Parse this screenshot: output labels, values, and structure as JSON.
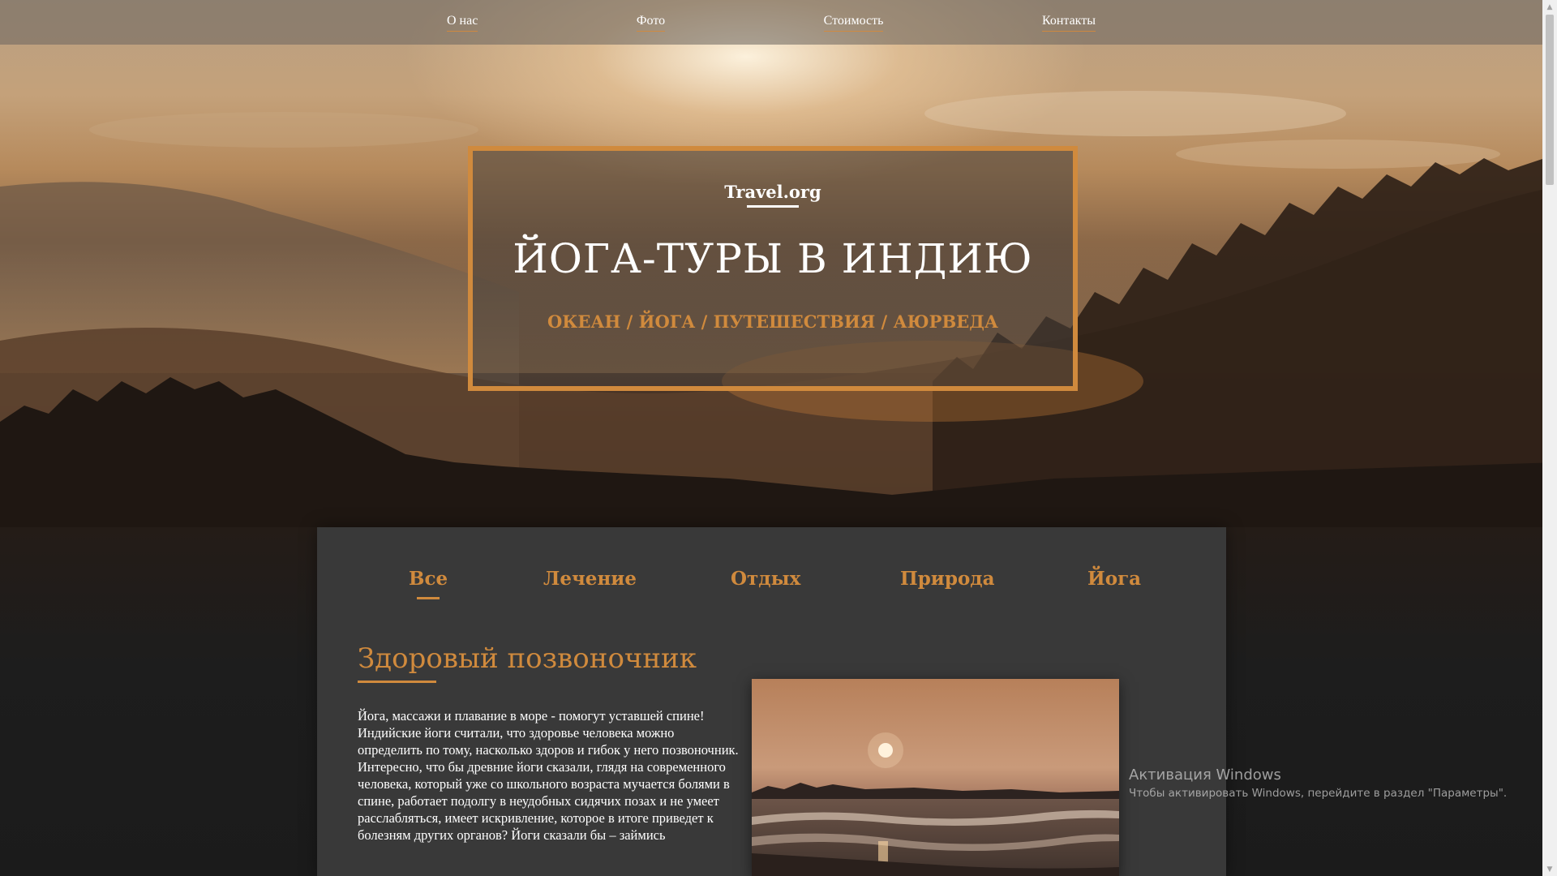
{
  "nav": {
    "items": [
      {
        "label": "О нас"
      },
      {
        "label": "Фото"
      },
      {
        "label": "Стоимость"
      },
      {
        "label": "Контакты"
      }
    ]
  },
  "hero": {
    "brand": "Travel.org",
    "title": "ЙОГА-ТУРЫ В ИНДИЮ",
    "tags": "ОКЕАН / ЙОГА / ПУТЕШЕСТВИЯ / АЮРВЕДА"
  },
  "filters": {
    "items": [
      {
        "label": "Все",
        "active": true
      },
      {
        "label": "Лечение",
        "active": false
      },
      {
        "label": "Отдых",
        "active": false
      },
      {
        "label": "Природа",
        "active": false
      },
      {
        "label": "Йога",
        "active": false
      }
    ]
  },
  "article": {
    "title": "Здоровый позвоночник",
    "paragraph1": "Йога, массажи и плавание в море - помогут уставшей спине! Индийские йоги считали, что здоровье человека можно определить по тому, насколько здоров и гибок у него позвоночник.",
    "paragraph2": "Интересно, что бы древние йоги сказали, глядя на современного человека, который уже со школьного возраста мучается болями в спине, работает подолгу в неудобных сидячих позах и не умеет расслабляться, имеет искривление, которое в итоге приведет к болезням других органов? Йоги сказали бы – займись"
  },
  "watermark": {
    "title": "Активация Windows",
    "text": "Чтобы активировать Windows, перейдите в раздел \"Параметры\"."
  },
  "colors": {
    "accent": "#d08a3d",
    "panel": "#393939",
    "nav_bg": "#69645e"
  },
  "icons": {
    "scroll_up": "triangle-up-icon",
    "scroll_down": "triangle-down-icon"
  }
}
